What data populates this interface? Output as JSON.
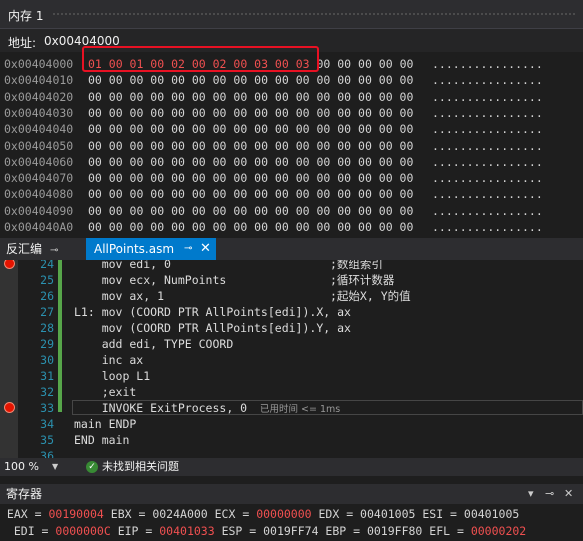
{
  "memory": {
    "title": "内存 1",
    "address_label": "地址:",
    "address_value": "0x00404000",
    "rows": [
      {
        "addr": "0x00404000",
        "changed": "01 00 01 00 02 00 02 00 03 00 03",
        "rest": " 00 00 00 00 00",
        "ascii": "................"
      },
      {
        "addr": "0x00404010",
        "changed": "",
        "rest": "00 00 00 00 00 00 00 00 00 00 00 00 00 00 00 00",
        "ascii": "................"
      },
      {
        "addr": "0x00404020",
        "changed": "",
        "rest": "00 00 00 00 00 00 00 00 00 00 00 00 00 00 00 00",
        "ascii": "................"
      },
      {
        "addr": "0x00404030",
        "changed": "",
        "rest": "00 00 00 00 00 00 00 00 00 00 00 00 00 00 00 00",
        "ascii": "................"
      },
      {
        "addr": "0x00404040",
        "changed": "",
        "rest": "00 00 00 00 00 00 00 00 00 00 00 00 00 00 00 00",
        "ascii": "................"
      },
      {
        "addr": "0x00404050",
        "changed": "",
        "rest": "00 00 00 00 00 00 00 00 00 00 00 00 00 00 00 00",
        "ascii": "................"
      },
      {
        "addr": "0x00404060",
        "changed": "",
        "rest": "00 00 00 00 00 00 00 00 00 00 00 00 00 00 00 00",
        "ascii": "................"
      },
      {
        "addr": "0x00404070",
        "changed": "",
        "rest": "00 00 00 00 00 00 00 00 00 00 00 00 00 00 00 00",
        "ascii": "................"
      },
      {
        "addr": "0x00404080",
        "changed": "",
        "rest": "00 00 00 00 00 00 00 00 00 00 00 00 00 00 00 00",
        "ascii": "................"
      },
      {
        "addr": "0x00404090",
        "changed": "",
        "rest": "00 00 00 00 00 00 00 00 00 00 00 00 00 00 00 00",
        "ascii": "................"
      },
      {
        "addr": "0x004040A0",
        "changed": "",
        "rest": "00 00 00 00 00 00 00 00 00 00 00 00 00 00 00 00",
        "ascii": "................"
      }
    ]
  },
  "tabs": {
    "disasm": "反汇编",
    "asm_file": "AllPoints.asm",
    "pin": "⊸",
    "close": "✕"
  },
  "code": {
    "lines": [
      {
        "ln": "24",
        "text": "    mov edi, 0",
        "comment": ";数组索引"
      },
      {
        "ln": "25",
        "text": "    mov ecx, NumPoints",
        "comment": ";循环计数器"
      },
      {
        "ln": "26",
        "text": "    mov ax, 1",
        "comment": ";起始X, Y的值"
      },
      {
        "ln": "27",
        "text": "L1: mov (COORD PTR AllPoints[edi]).X, ax",
        "comment": ""
      },
      {
        "ln": "28",
        "text": "    mov (COORD PTR AllPoints[edi]).Y, ax",
        "comment": ""
      },
      {
        "ln": "29",
        "text": "    add edi, TYPE COORD",
        "comment": ""
      },
      {
        "ln": "30",
        "text": "    inc ax",
        "comment": ""
      },
      {
        "ln": "31",
        "text": "    loop L1",
        "comment": ""
      },
      {
        "ln": "32",
        "text": "    ;exit",
        "comment": ""
      },
      {
        "ln": "33",
        "text": "    INVOKE ExitProcess, 0",
        "comment": ""
      },
      {
        "ln": "34",
        "text": "main ENDP",
        "comment": ""
      },
      {
        "ln": "35",
        "text": "END main",
        "comment": ""
      },
      {
        "ln": "36",
        "text": "",
        "comment": ""
      }
    ],
    "elapsed": "已用时间 <= 1ms"
  },
  "status": {
    "zoom": "100 %",
    "issues": "未找到相关问题"
  },
  "registers": {
    "title": "寄存器",
    "row1": [
      {
        "t": " EAX = "
      },
      {
        "t": "00190004",
        "c": true
      },
      {
        "t": " EBX = 0024A000 ECX = "
      },
      {
        "t": "00000000",
        "c": true
      },
      {
        "t": " EDX = 00401005 ESI = 00401005"
      }
    ],
    "row2": [
      {
        "t": "  EDI = "
      },
      {
        "t": "0000000C",
        "c": true
      },
      {
        "t": " EIP = "
      },
      {
        "t": "00401033",
        "c": true
      },
      {
        "t": " ESP = 0019FF74 EBP = 0019FF80 EFL = "
      },
      {
        "t": "00000202",
        "c": true
      }
    ]
  },
  "colors": {
    "accent": "#007acc",
    "changed": "#f05050",
    "highlight_box": "#e81123"
  }
}
